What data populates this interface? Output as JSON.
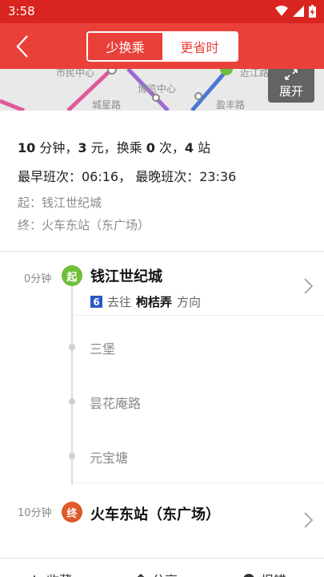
{
  "status": {
    "time": "3:58"
  },
  "header": {
    "tabs": [
      "少换乘",
      "更省时"
    ]
  },
  "map": {
    "labels": [
      "市民中心",
      "博览中心",
      "城星路",
      "盈丰路",
      "近江路"
    ],
    "expand_label": "展开"
  },
  "summary": {
    "minutes": "10",
    "minutes_unit": " 分钟，",
    "fare": "3",
    "fare_unit": " 元，换乘 ",
    "transfers": "0",
    "transfers_unit": " 次，",
    "stops": "4",
    "stops_unit": " 站",
    "schedule": "最早班次：06:16， 最晚班次：23:36",
    "from": "起：钱江世纪城",
    "to": "终：火车东站（东广场）"
  },
  "route": {
    "start": {
      "time": "0分钟",
      "badge": "起",
      "name": "钱江世纪城"
    },
    "line": {
      "number": "6",
      "prefix": "去往",
      "terminus": "枸桔弄",
      "suffix": "方向"
    },
    "stops": [
      "三堡",
      "昙花庵路",
      "元宝塘"
    ],
    "end": {
      "time": "10分钟",
      "badge": "终",
      "name": "火车东站（东广场）"
    }
  },
  "bottom": {
    "items": [
      "收藏",
      "分享",
      "报错"
    ]
  },
  "colors": {
    "brand": "#e9413a",
    "line6": "#2b57c6",
    "start": "#6fbf3a",
    "end": "#e05a2b"
  }
}
